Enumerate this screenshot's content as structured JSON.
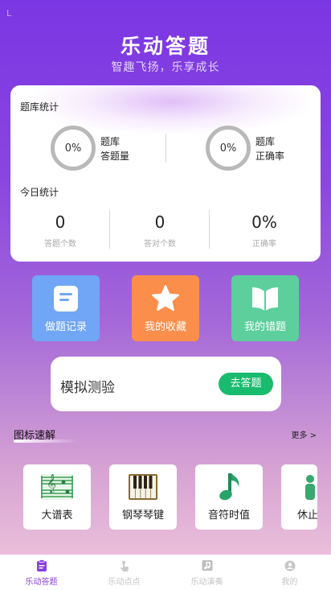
{
  "status": {
    "indicator": "L"
  },
  "header": {
    "title": "乐动答题",
    "subtitle": "智趣飞扬，乐享成长"
  },
  "bank_stats": {
    "section_label": "题库统计",
    "left": {
      "value": "0%",
      "line1": "题库",
      "line2": "答题量"
    },
    "right": {
      "value": "0%",
      "line1": "题库",
      "line2": "正确率"
    }
  },
  "today_stats": {
    "section_label": "今日统计",
    "items": [
      {
        "value": "0",
        "caption": "答题个数"
      },
      {
        "value": "0",
        "caption": "答对个数"
      },
      {
        "value": "0%",
        "caption": "正确率"
      }
    ]
  },
  "quick_tiles": [
    {
      "label": "做题记录",
      "icon": "document-icon",
      "color": "#70a6f5"
    },
    {
      "label": "我的收藏",
      "icon": "star-icon",
      "color": "#fb8e4a"
    },
    {
      "label": "我的错题",
      "icon": "book-icon",
      "color": "#5ccf9c"
    }
  ],
  "mock_test": {
    "title": "模拟测验",
    "button": "去答题"
  },
  "icon_section": {
    "title": "图标速解",
    "more": "更多 >",
    "items": [
      {
        "label": "大谱表",
        "icon": "grand-staff-icon"
      },
      {
        "label": "钢琴琴键",
        "icon": "piano-keys-icon"
      },
      {
        "label": "音符时值",
        "icon": "music-note-icon"
      },
      {
        "label": "休止",
        "icon": "rest-icon"
      }
    ]
  },
  "tabbar": {
    "tabs": [
      {
        "label": "乐动答题",
        "icon": "clipboard-icon",
        "active": true
      },
      {
        "label": "乐动点点",
        "icon": "tap-icon",
        "active": false
      },
      {
        "label": "乐动演奏",
        "icon": "music-icon",
        "active": false
      },
      {
        "label": "我的",
        "icon": "user-icon",
        "active": false
      }
    ]
  },
  "colors": {
    "primary": "#8a3fe0",
    "accent_green": "#19bb6f"
  }
}
